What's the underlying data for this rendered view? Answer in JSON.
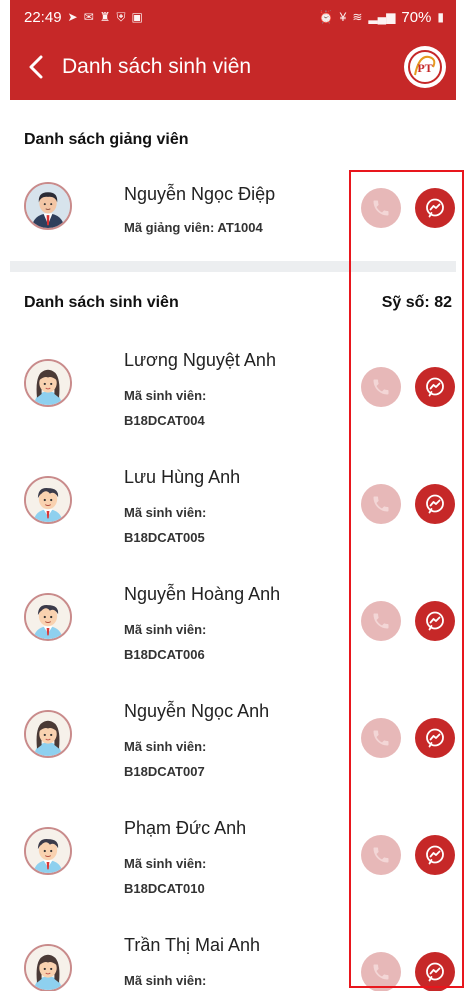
{
  "status": {
    "time": "22:49",
    "battery": "70%",
    "left_icons": [
      "telegram-icon",
      "gmail-icon",
      "app-icon",
      "shield-icon",
      "image-icon"
    ],
    "right_icons": [
      "alarm-icon",
      "volte-icon",
      "wifi-icon",
      "signal-icon",
      "battery-icon"
    ]
  },
  "appbar": {
    "title": "Danh sách sinh viên",
    "logo_text": "PT"
  },
  "lecturers": {
    "title": "Danh sách giảng viên",
    "items": [
      {
        "name": "Nguyễn Ngọc Điệp",
        "meta": "Mã giảng viên: AT1004",
        "avatar": "male-teacher"
      }
    ]
  },
  "students": {
    "title": "Danh sách sinh viên",
    "count_label": "Sỹ số: 82",
    "id_label": "Mã sinh viên:",
    "items": [
      {
        "name": "Lương Nguyệt Anh",
        "id": "B18DCAT004",
        "avatar": "female-student"
      },
      {
        "name": "Lưu Hùng Anh",
        "id": "B18DCAT005",
        "avatar": "male-student"
      },
      {
        "name": "Nguyễn Hoàng Anh",
        "id": "B18DCAT006",
        "avatar": "male-student"
      },
      {
        "name": "Nguyễn Ngọc Anh",
        "id": "B18DCAT007",
        "avatar": "female-student"
      },
      {
        "name": "Phạm Đức Anh",
        "id": "B18DCAT010",
        "avatar": "male-student"
      },
      {
        "name": "Trần Thị Mai Anh",
        "id": "",
        "avatar": "female-student"
      }
    ]
  },
  "colors": {
    "primary": "#c62828",
    "call_disabled": "#e7b8b8",
    "highlight": "#e8161d",
    "divider": "#eceef0"
  }
}
